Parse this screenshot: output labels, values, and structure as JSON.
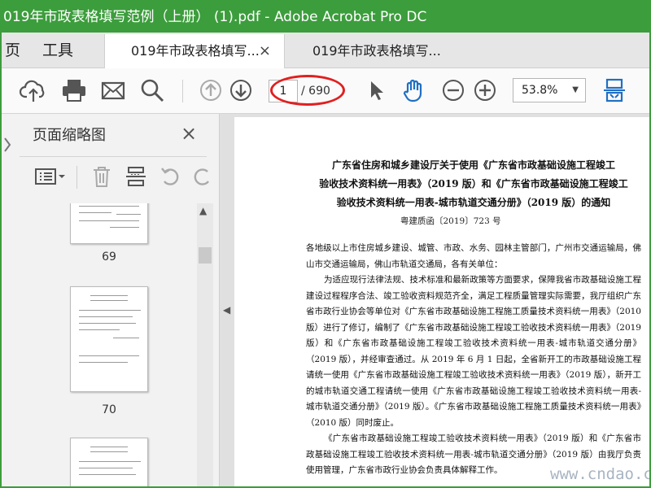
{
  "window": {
    "title": "019年市政表格填写范例（上册） (1).pdf - Adobe Acrobat Pro DC"
  },
  "nav": {
    "home": "页",
    "tools": "工具"
  },
  "tabs": [
    {
      "label": "019年市政表格填写...",
      "close": "×"
    },
    {
      "label": "019年市政表格填写..."
    }
  ],
  "toolbar": {
    "page_current": "1",
    "page_total": "/ 690",
    "zoom": "53.8%",
    "highlight_color": "#e02020"
  },
  "side_panel": {
    "title": "页面缩略图",
    "close": "×",
    "thumbnails": [
      {
        "label": "69"
      },
      {
        "label": "70"
      }
    ]
  },
  "document": {
    "title_lines": [
      "广东省住房和城乡建设厅关于使用《广东省市政基础设施工程竣工",
      "验收技术资料统一用表》（2019 版）和《广东省市政基础设施工程竣工",
      "验收技术资料统一用表-城市轨道交通分册》（2019 版）的通知"
    ],
    "ref": "粤建质函〔2019〕723 号",
    "paragraphs": [
      "各地级以上市住房城乡建设、城管、市政、水务、园林主管部门，广州市交通运输局，佛山市交通运输局，佛山市轨道交通局，各有关单位：",
      "为适应现行法律法规、技术标准和最新政策等方面要求，保障我省市政基础设施工程建设过程程序合法、竣工验收资料规范齐全，满足工程质量管理实际需要，我厅组织广东省市政行业协会等单位对《广东省市政基础设施工程施工质量技术资料统一用表》（2010 版）进行了修订，编制了《广东省市政基础设施工程竣工验收技术资料统一用表》（2019 版）和《广东省市政基础设施工程竣工验收技术资料统一用表-城市轨道交通分册》（2019 版），并经审查通过。从 2019 年 6 月 1 日起，全省新开工的市政基础设施工程请统一使用《广东省市政基础设施工程竣工验收技术资料统一用表》（2019 版），新开工的城市轨道交通工程请统一使用《广东省市政基础设施工程竣工验收技术资料统一用表-城市轨道交通分册》（2019 版）。《广东省市政基础设施工程施工质量技术资料统一用表》（2010 版）同时废止。",
      "《广东省市政基础设施工程竣工验收技术资料统一用表》（2019 版）和《广东省市政基础设施工程竣工验收技术资料统一用表-城市轨道交通分册》（2019 版）由我厅负责使用管理，广东省市政行业协会负责具体解释工作。"
    ]
  },
  "watermark": "www.cndao.com",
  "colors": {
    "titlebar": "#3c9d3c",
    "accent_blue": "#1f6fc4"
  }
}
